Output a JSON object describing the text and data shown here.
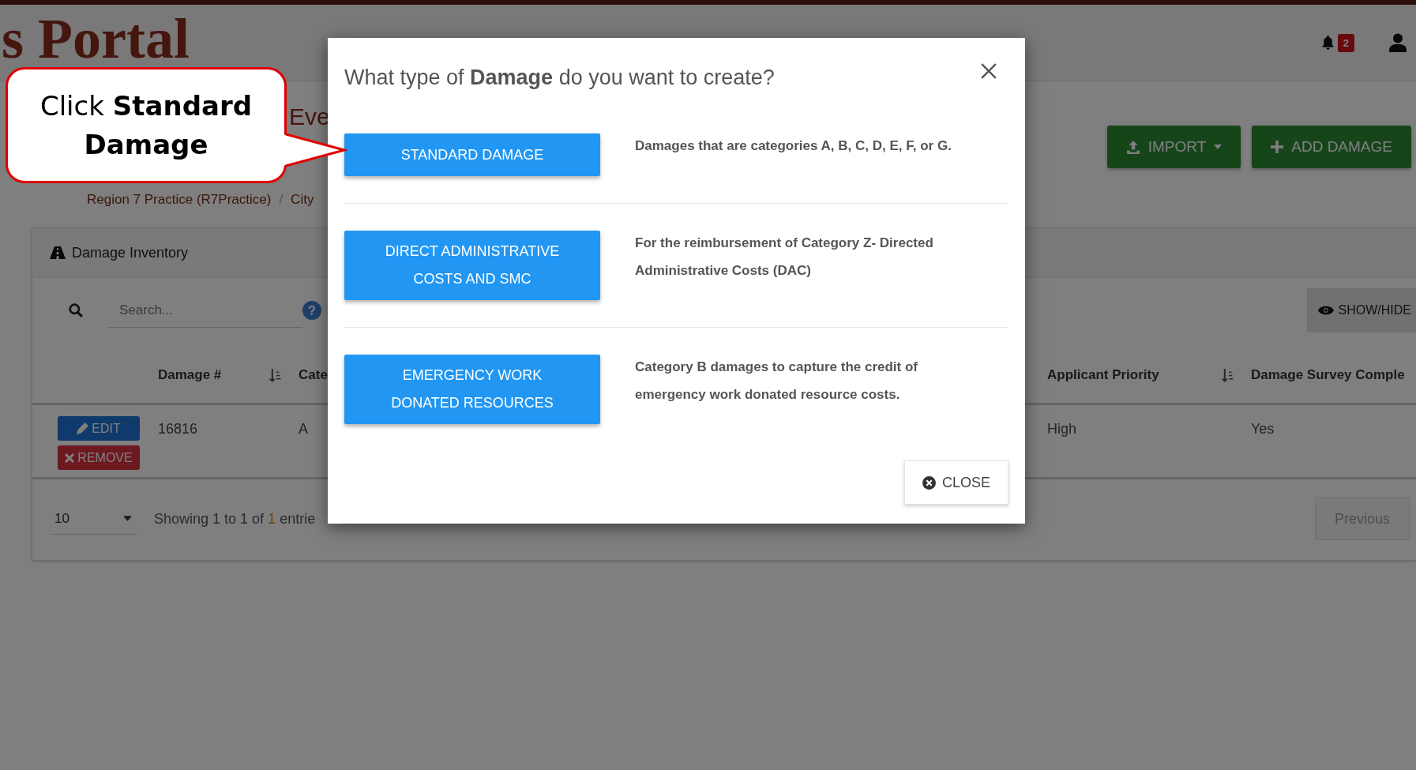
{
  "header": {
    "logo": "s Portal",
    "notifications": "2"
  },
  "page": {
    "title": "Eve",
    "breadcrumb": [
      "Region 7 Practice (R7Practice)",
      "City"
    ],
    "separator": "/",
    "actions": [
      {
        "kind": "import",
        "label": "IMPORT"
      },
      {
        "kind": "add",
        "label": "ADD DAMAGE"
      }
    ]
  },
  "panel": {
    "title": "Damage Inventory",
    "search": {
      "placeholder": "Search...",
      "help": "?"
    },
    "show_hide": "SHOW/HIDE",
    "columns": [
      {
        "label": "Damage #",
        "sortable": true
      },
      {
        "label": "Cate",
        "sortable": false
      },
      {
        "label": "Applicant Priority",
        "sortable": true
      },
      {
        "label": "Damage Survey Comple",
        "sortable": false
      }
    ],
    "rows": [
      {
        "actions": [
          {
            "kind": "edit",
            "label": "EDIT"
          },
          {
            "kind": "remove",
            "label": "REMOVE"
          }
        ],
        "cells": [
          "16816",
          "A",
          "High",
          "Yes"
        ]
      }
    ],
    "page_size": "10",
    "info": {
      "text": "Showing 1 to 1 of",
      "count": "1",
      "rest": "entrie"
    },
    "previous": "Previous"
  },
  "modal": {
    "title": "What type of **Damage** do you want to create?",
    "options": [
      {
        "button": "STANDARD DAMAGE",
        "description": "Damages that are categories A, B, C, D, E, F, or G."
      },
      {
        "button": "DIRECT ADMINISTRATIVE COSTS AND SMC",
        "description": "For the reimbursement of Category Z- Directed Administrative Costs (DAC)"
      },
      {
        "button": "EMERGENCY WORK DONATED RESOURCES",
        "description": "Category B damages to capture the credit of emergency work donated resource costs."
      }
    ],
    "close": "CLOSE"
  },
  "callout": {
    "text": "Click **Standard Damage**"
  }
}
